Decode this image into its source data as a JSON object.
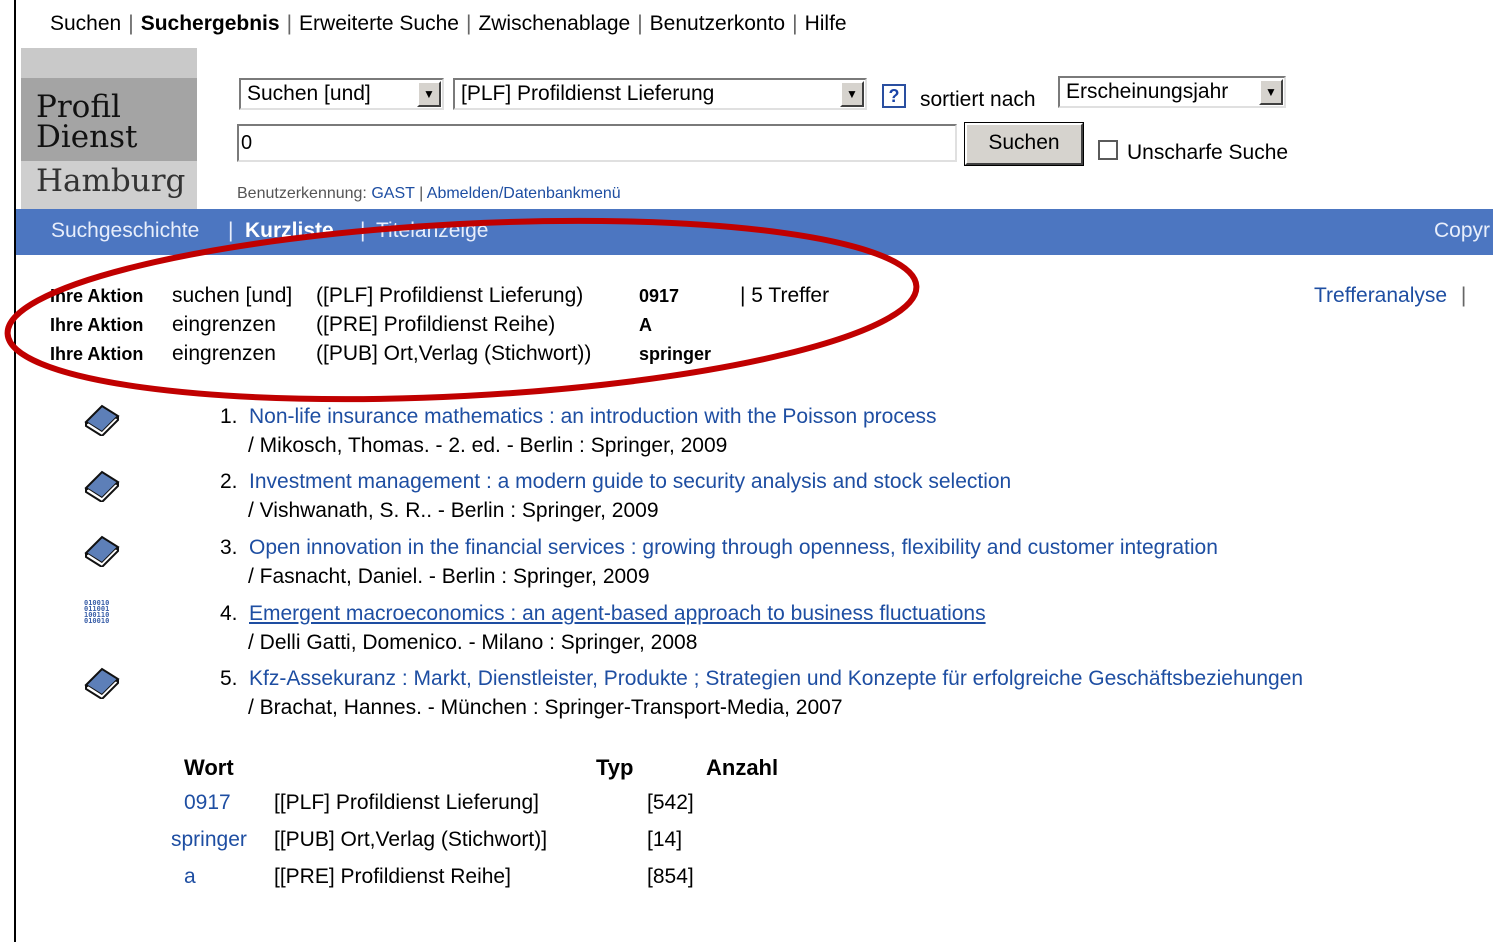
{
  "topmenu": {
    "items": [
      "Suchen",
      "Suchergebnis",
      "Erweiterte Suche",
      "Zwischenablage",
      "Benutzerkonto",
      "Hilfe"
    ]
  },
  "logo": {
    "line1": "Profil",
    "line2": "Dienst",
    "line3": "Hamburg"
  },
  "search": {
    "operator": "Suchen [und]",
    "index": "[PLF] Profildienst Lieferung",
    "help": "?",
    "sort_label": "sortiert nach",
    "sort_value": "Erscheinungsjahr",
    "query": "0",
    "button": "Suchen",
    "fuzzy_label": "Unscharfe Suche"
  },
  "user": {
    "label": "Benutzerkennung:",
    "name": "GAST",
    "sep": "|",
    "logout": "Abmelden/Datenbankmenü"
  },
  "subnav": {
    "history": "Suchgeschichte",
    "sep1": "|",
    "short": "Kurzliste",
    "sep2": "|",
    "title": "Titelanzeige",
    "right": "Copyr"
  },
  "actions": [
    {
      "label": "Ihre Aktion",
      "verb": "suchen [und]",
      "index": "([PLF] Profildienst Lieferung)",
      "term": "0917",
      "hits": "| 5 Treffer"
    },
    {
      "label": "Ihre Aktion",
      "verb": "eingrenzen",
      "index": "([PRE] Profildienst Reihe)",
      "term": "A"
    },
    {
      "label": "Ihre Aktion",
      "verb": "eingrenzen",
      "index": "([PUB] Ort,Verlag (Stichwort))",
      "term": "springer"
    }
  ],
  "analysis": {
    "link": "Trefferanalyse",
    "sep": "|"
  },
  "results": [
    {
      "num": "1.",
      "title": "Non-life insurance mathematics : an introduction with the Poisson process",
      "sub": "/ Mikosch, Thomas. - 2. ed. - Berlin : Springer, 2009",
      "icon": "book-icon"
    },
    {
      "num": "2.",
      "title": "Investment management : a modern guide to security analysis and stock selection",
      "sub": "/ Vishwanath, S. R.. - Berlin : Springer, 2009",
      "icon": "book-icon"
    },
    {
      "num": "3.",
      "title": "Open innovation in the financial services : growing through openness, flexibility and customer integration",
      "sub": "/ Fasnacht, Daniel. - Berlin : Springer, 2009",
      "icon": "book-icon"
    },
    {
      "num": "4.",
      "title": "Emergent macroeconomics : an agent-based approach to business fluctuations",
      "sub": "/ Delli Gatti, Domenico. - Milano : Springer, 2008",
      "icon": "digital-icon"
    },
    {
      "num": "5.",
      "title": "Kfz-Assekuranz : Markt, Dienstleister, Produkte ; Strategien und Konzepte für erfolgreiche Geschäftsbeziehungen",
      "sub": "/ Brachat, Hannes. - München : Springer-Transport-Media, 2007",
      "icon": "book-icon"
    }
  ],
  "wordtable": {
    "headers": {
      "wort": "Wort",
      "typ": "Typ",
      "anzahl": "Anzahl"
    },
    "rows": [
      {
        "wort": "0917",
        "typ": "[[PLF] Profildienst Lieferung]",
        "anzahl": "[542]"
      },
      {
        "wort": "springer",
        "typ": "[[PUB] Ort,Verlag (Stichwort)]",
        "anzahl": "[14]"
      },
      {
        "wort": "a",
        "typ": "[[PRE] Profildienst Reihe]",
        "anzahl": "[854]"
      }
    ]
  },
  "colors": {
    "bar": "#4c76c1",
    "link": "#1e4ea2",
    "annotation": "#c00000"
  }
}
